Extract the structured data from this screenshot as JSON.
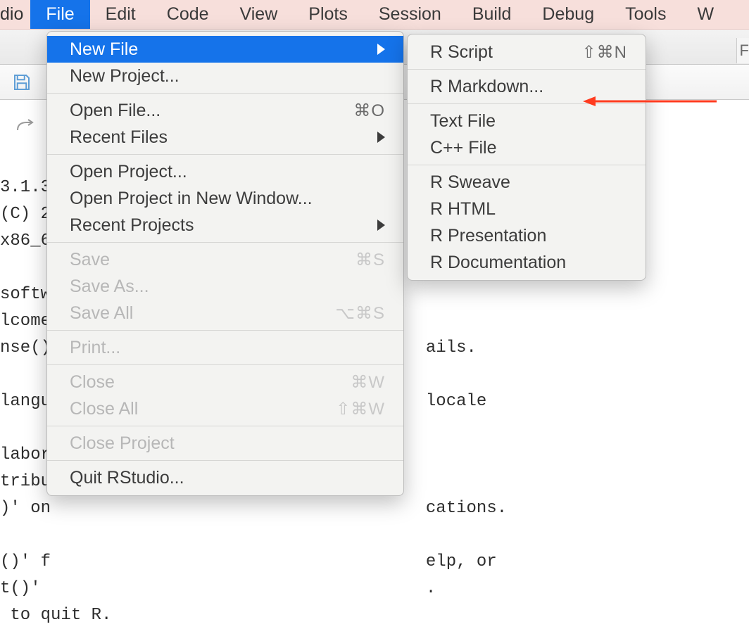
{
  "menubar": {
    "appname": "dio",
    "items": [
      "File",
      "Edit",
      "Code",
      "View",
      "Plots",
      "Session",
      "Build",
      "Debug",
      "Tools",
      "W"
    ],
    "active_index": 0
  },
  "file_menu": {
    "groups": [
      [
        {
          "label": "New File",
          "shortcut": "",
          "submenu": true,
          "disabled": false,
          "highlight": true
        },
        {
          "label": "New Project...",
          "shortcut": "",
          "submenu": false,
          "disabled": false
        }
      ],
      [
        {
          "label": "Open File...",
          "shortcut": "⌘O",
          "submenu": false,
          "disabled": false
        },
        {
          "label": "Recent Files",
          "shortcut": "",
          "submenu": true,
          "disabled": false
        }
      ],
      [
        {
          "label": "Open Project...",
          "shortcut": "",
          "submenu": false,
          "disabled": false
        },
        {
          "label": "Open Project in New Window...",
          "shortcut": "",
          "submenu": false,
          "disabled": false
        },
        {
          "label": "Recent Projects",
          "shortcut": "",
          "submenu": true,
          "disabled": false
        }
      ],
      [
        {
          "label": "Save",
          "shortcut": "⌘S",
          "submenu": false,
          "disabled": true
        },
        {
          "label": "Save As...",
          "shortcut": "",
          "submenu": false,
          "disabled": true
        },
        {
          "label": "Save All",
          "shortcut": "⌥⌘S",
          "submenu": false,
          "disabled": true
        }
      ],
      [
        {
          "label": "Print...",
          "shortcut": "",
          "submenu": false,
          "disabled": true
        }
      ],
      [
        {
          "label": "Close",
          "shortcut": "⌘W",
          "submenu": false,
          "disabled": true
        },
        {
          "label": "Close All",
          "shortcut": "⇧⌘W",
          "submenu": false,
          "disabled": true
        }
      ],
      [
        {
          "label": "Close Project",
          "shortcut": "",
          "submenu": false,
          "disabled": true
        }
      ],
      [
        {
          "label": "Quit RStudio...",
          "shortcut": "",
          "submenu": false,
          "disabled": false
        }
      ]
    ]
  },
  "newfile_submenu": {
    "groups": [
      [
        {
          "label": "R Script",
          "shortcut": "⇧⌘N"
        }
      ],
      [
        {
          "label": "R Markdown...",
          "shortcut": ""
        }
      ],
      [
        {
          "label": "Text File",
          "shortcut": ""
        },
        {
          "label": "C++ File",
          "shortcut": ""
        }
      ],
      [
        {
          "label": "R Sweave",
          "shortcut": ""
        },
        {
          "label": "R HTML",
          "shortcut": ""
        },
        {
          "label": "R Presentation",
          "shortcut": ""
        },
        {
          "label": "R Documentation",
          "shortcut": ""
        }
      ]
    ]
  },
  "console_lines": [
    "",
    "3.1.3",
    "(C) 2",
    "x86_6",
    "",
    "softw",
    "lcome",
    "nse()                                     ails.",
    "",
    "langu                                     locale",
    "",
    "labor",
    "tribu",
    ")' on                                     cations.",
    "",
    "()' f                                     elp, or",
    "t()'                                      .",
    " to quit R."
  ],
  "right_stub_char": "F"
}
